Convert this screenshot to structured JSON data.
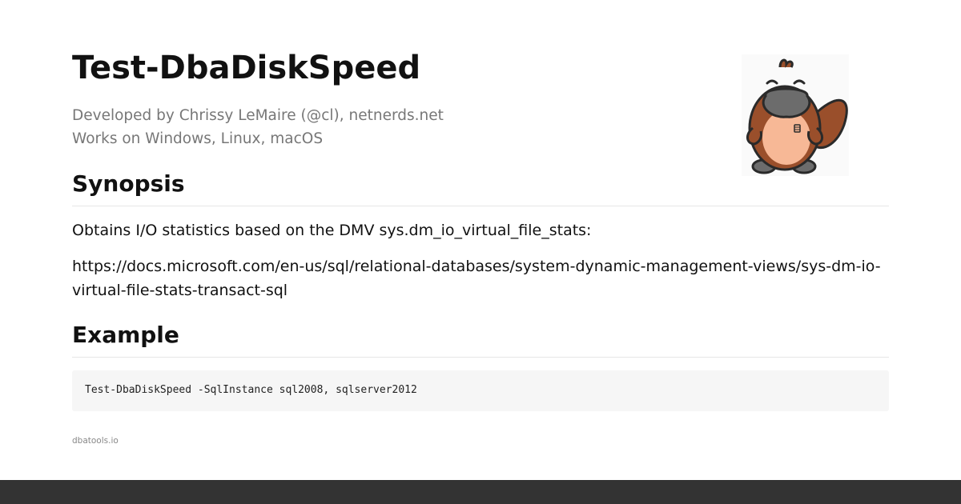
{
  "page": {
    "title": "Test-DbaDiskSpeed",
    "developed_by": "Developed by Chrissy LeMaire (@cl), netnerds.net",
    "platforms": "Works on Windows, Linux, macOS"
  },
  "synopsis": {
    "heading": "Synopsis",
    "description": "Obtains I/O statistics based on the DMV sys.dm_io_virtual_file_stats:",
    "url": "https://docs.microsoft.com/en-us/sql/relational-databases/system-dynamic-management-views/sys-dm-io-virtual-file-stats-transact-sql"
  },
  "example": {
    "heading": "Example",
    "code": "Test-DbaDiskSpeed -SqlInstance sql2008, sqlserver2012"
  },
  "footer": {
    "site": "dbatools.io"
  },
  "mascot": {
    "icon": "platypus-mascot-icon"
  },
  "colors": {
    "text": "#111111",
    "muted": "#777777",
    "code_bg": "#f6f6f6",
    "bottom_bar": "#333333",
    "mascot_body": "#9a4f2b",
    "mascot_belly": "#f7b896",
    "mascot_bill": "#6c6c6c"
  }
}
